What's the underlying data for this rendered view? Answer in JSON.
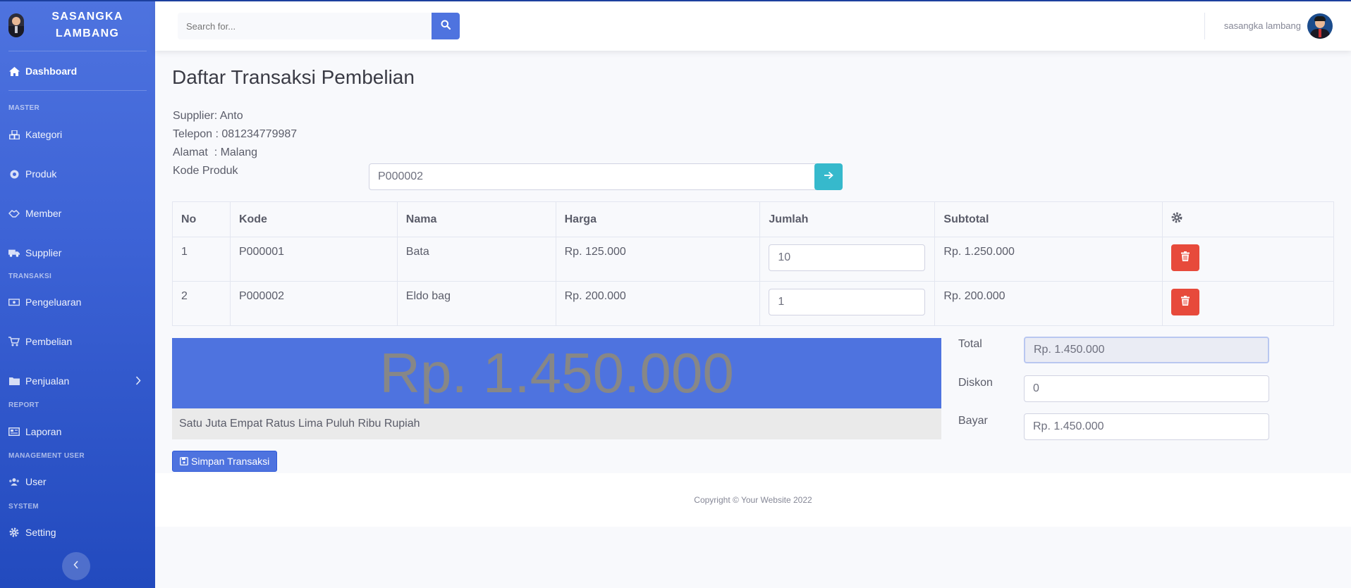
{
  "brand": {
    "line1": "SASANGKA",
    "line2": "LAMBANG"
  },
  "sidebar": {
    "dashboard": "Dashboard",
    "headings": {
      "master": "MASTER",
      "transaksi": "TRANSAKSI",
      "report": "REPORT",
      "management": "MANAGEMENT USER",
      "system": "SYSTEM"
    },
    "items": {
      "kategori": "Kategori",
      "produk": "Produk",
      "member": "Member",
      "supplier": "Supplier",
      "pengeluaran": "Pengeluaran",
      "pembelian": "Pembelian",
      "penjualan": "Penjualan",
      "laporan": "Laporan",
      "user": "User",
      "setting": "Setting"
    }
  },
  "topbar": {
    "search_placeholder": "Search for...",
    "user_name": "sasangka lambang"
  },
  "page": {
    "title": "Daftar Transaksi Pembelian",
    "supplier_label": "Supplier",
    "supplier_value": "Anto",
    "telepon_label": "Telepon",
    "telepon_value": "081234779987",
    "alamat_label": "Alamat",
    "alamat_value": "Malang",
    "kode_label": "Kode Produk",
    "kode_value": "P000002"
  },
  "table": {
    "headers": {
      "no": "No",
      "kode": "Kode",
      "nama": "Nama",
      "harga": "Harga",
      "jumlah": "Jumlah",
      "subtotal": "Subtotal"
    },
    "rows": [
      {
        "no": "1",
        "kode": "P000001",
        "nama": "Bata",
        "harga": "Rp. 125.000",
        "jumlah": "10",
        "subtotal": "Rp. 1.250.000"
      },
      {
        "no": "2",
        "kode": "P000002",
        "nama": "Eldo bag",
        "harga": "Rp. 200.000",
        "jumlah": "1",
        "subtotal": "Rp. 200.000"
      }
    ]
  },
  "summary": {
    "big_total": "Rp. 1.450.000",
    "terbilang": "Satu Juta Empat Ratus Lima Puluh Ribu Rupiah",
    "total_label": "Total",
    "total_value": "Rp. 1.450.000",
    "diskon_label": "Diskon",
    "diskon_value": "0",
    "bayar_label": "Bayar",
    "bayar_value": "Rp. 1.450.000"
  },
  "save_label": "Simpan Transaksi",
  "footer": "Copyright © Your Website 2022",
  "colors": {
    "primary": "#4e73df",
    "info": "#36b9cc",
    "danger": "#e74a3b"
  }
}
